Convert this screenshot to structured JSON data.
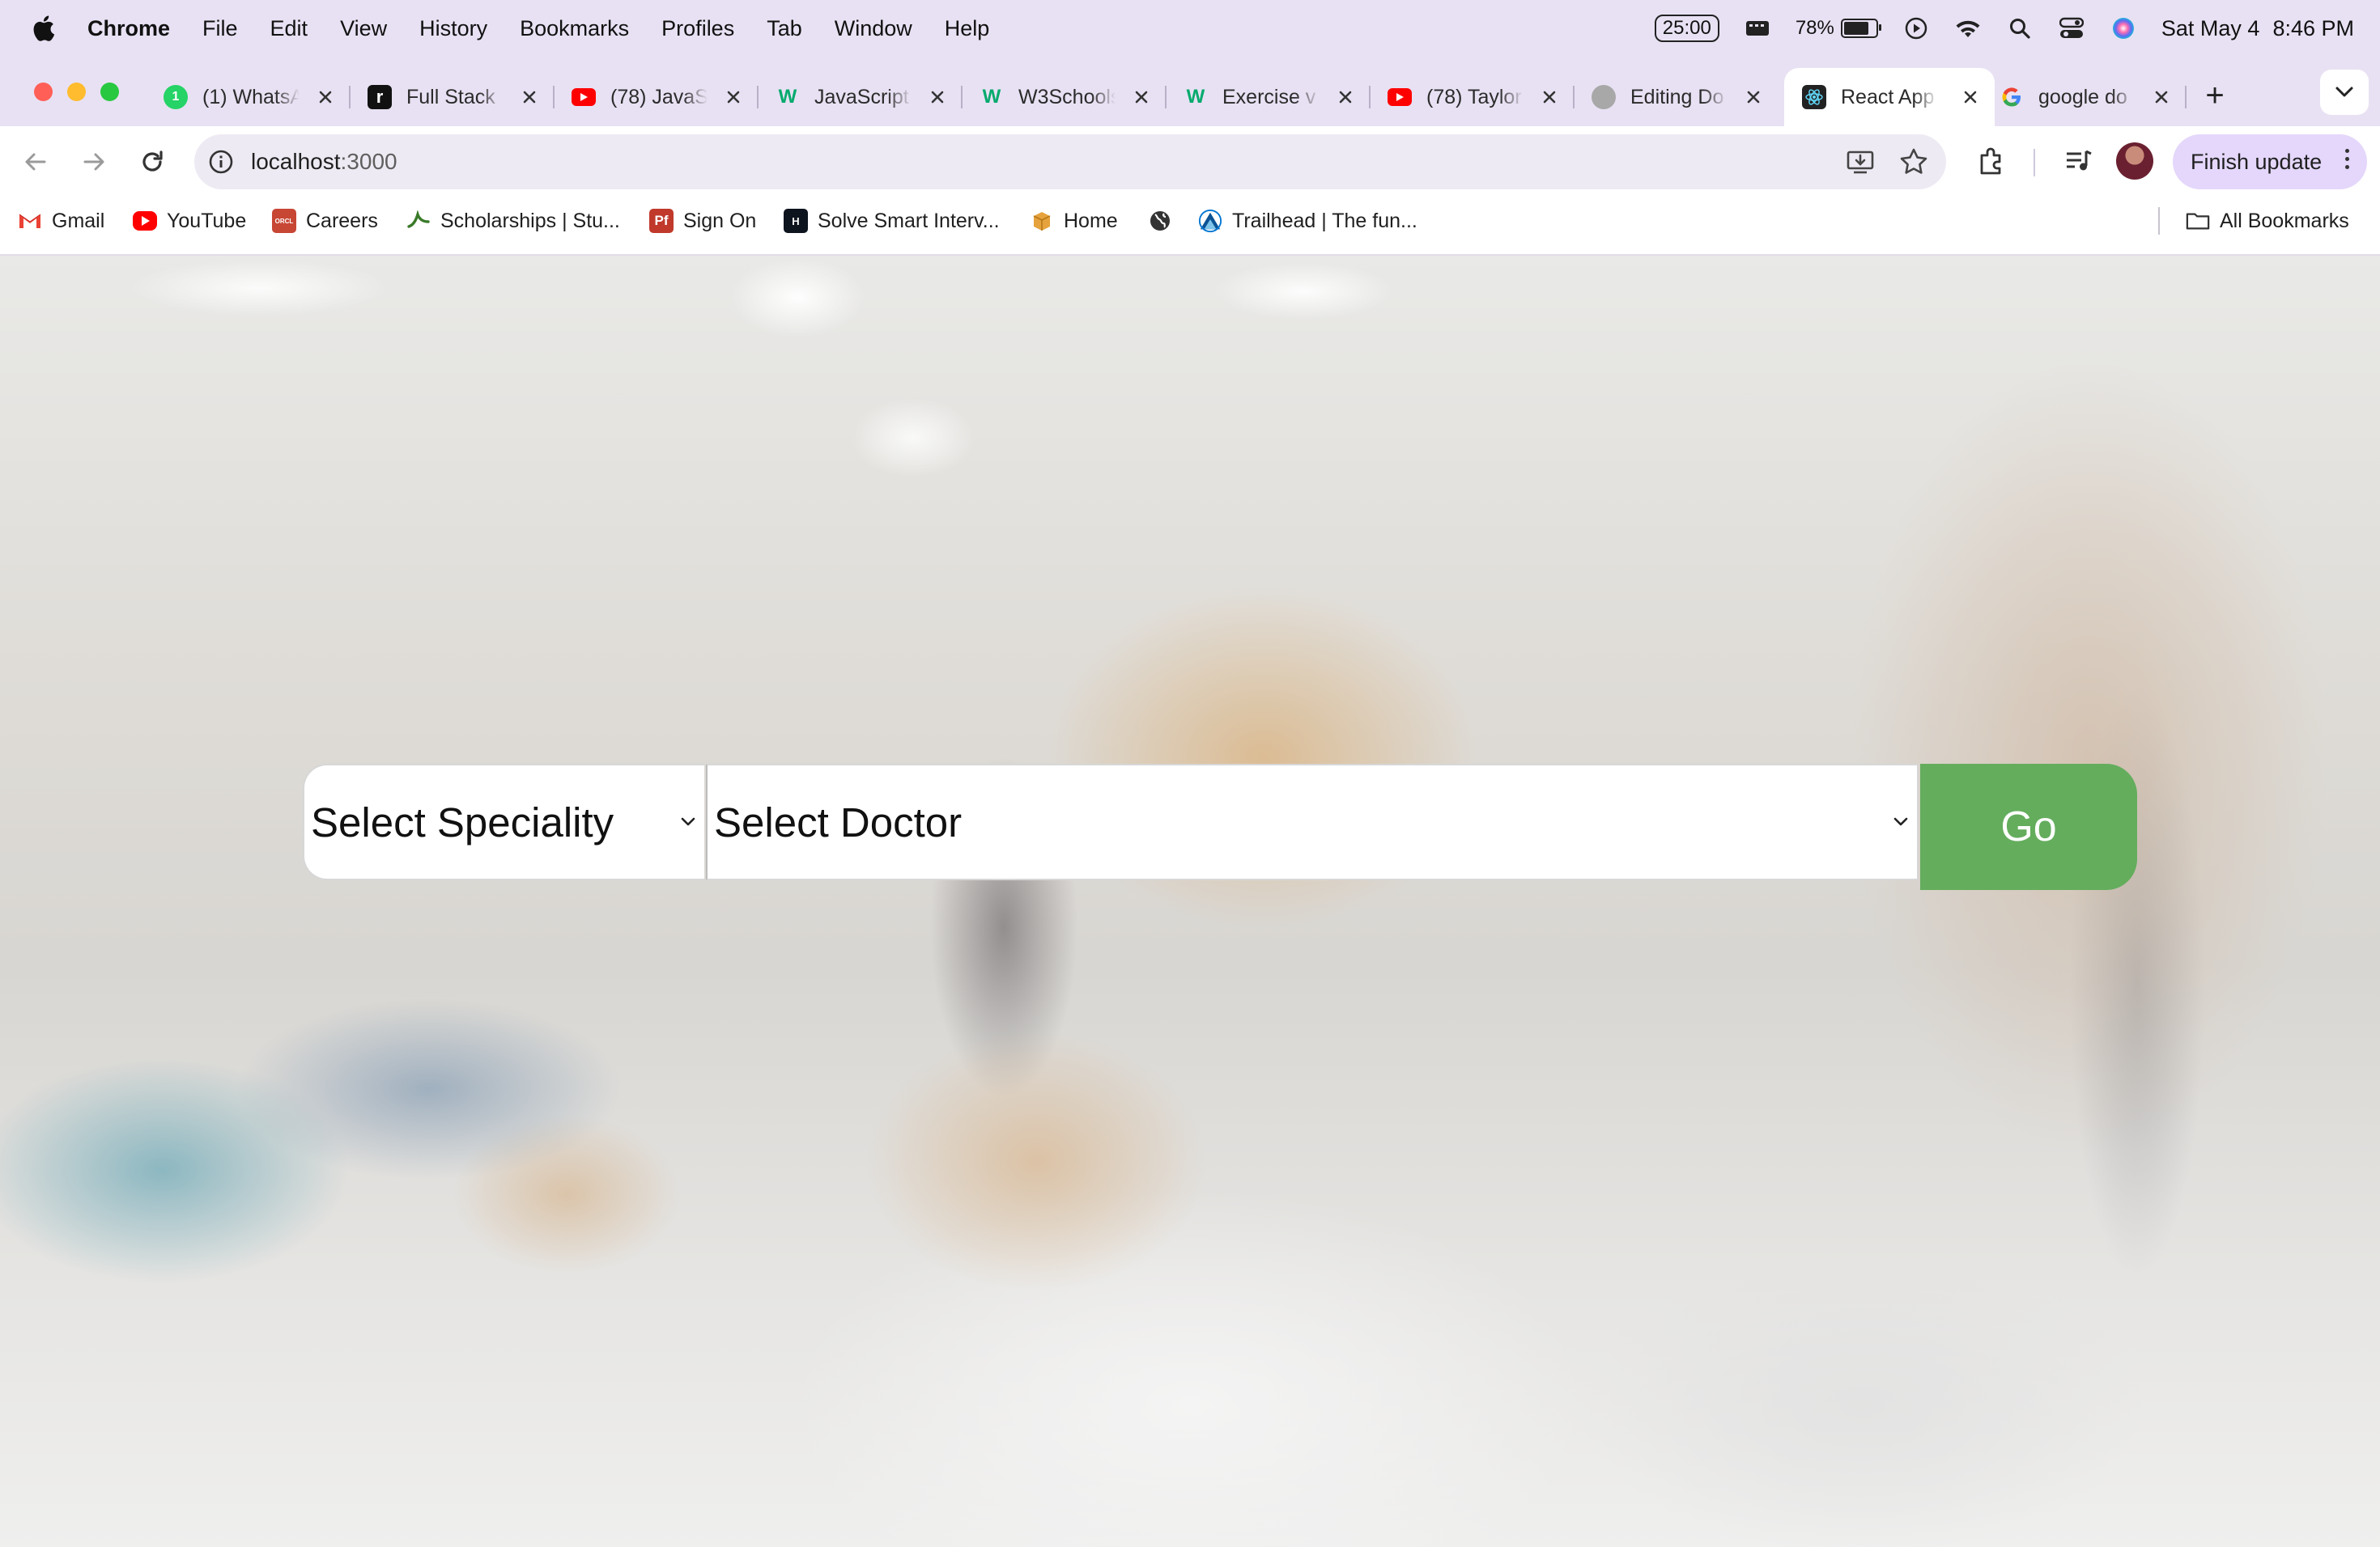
{
  "menubar": {
    "app_name": "Chrome",
    "items": [
      "File",
      "Edit",
      "View",
      "History",
      "Bookmarks",
      "Profiles",
      "Tab",
      "Window",
      "Help"
    ],
    "timer": "25:00",
    "battery_percent": "78%",
    "battery_level": 0.78,
    "date": "Sat May 4",
    "time": "8:46 PM"
  },
  "tabs": [
    {
      "title": "(1) WhatsApp",
      "icon": "whatsapp-icon",
      "color": "#25d366",
      "active": false
    },
    {
      "title": "Full Stack",
      "icon": "roadmap-icon",
      "color": "#111111",
      "active": false
    },
    {
      "title": "(78) JavaScript",
      "icon": "youtube-icon",
      "color": "#ff0000",
      "active": false
    },
    {
      "title": "JavaScript",
      "icon": "w3schools-icon",
      "color": "#04aa6d",
      "active": false
    },
    {
      "title": "W3Schools",
      "icon": "w3schools-icon",
      "color": "#04aa6d",
      "active": false
    },
    {
      "title": "Exercise v",
      "icon": "w3schools-icon",
      "color": "#04aa6d",
      "active": false
    },
    {
      "title": "(78) Taylor",
      "icon": "youtube-icon",
      "color": "#ff0000",
      "active": false
    },
    {
      "title": "Editing Do",
      "icon": "github-icon",
      "color": "#a8a8a8",
      "active": false
    },
    {
      "title": "React App",
      "icon": "react-icon",
      "color": "#61dafb",
      "active": true
    },
    {
      "title": "google do",
      "icon": "google-icon",
      "color": "#4285f4",
      "active": false
    }
  ],
  "toolbar": {
    "url_host": "localhost",
    "url_port": ":3000",
    "finish_update_label": "Finish update"
  },
  "bookmarks": [
    {
      "label": "Gmail",
      "icon": "gmail-icon",
      "color": "#ea4335"
    },
    {
      "label": "YouTube",
      "icon": "youtube-icon",
      "color": "#ff0000"
    },
    {
      "label": "Careers",
      "icon": "oracle-icon",
      "color": "#c74634"
    },
    {
      "label": "Scholarships | Stu...",
      "icon": "scholarship-icon",
      "color": "#3a7a2a"
    },
    {
      "label": "Sign On",
      "icon": "pf-icon",
      "color": "#c0392b"
    },
    {
      "label": "Solve Smart Interv...",
      "icon": "hackerrank-icon",
      "color": "#0e141e"
    },
    {
      "label": "Home",
      "icon": "box-icon",
      "color": "#e6a23c"
    },
    {
      "label": "",
      "icon": "globe-icon",
      "color": "#333333"
    },
    {
      "label": "Trailhead | The fun...",
      "icon": "trailhead-icon",
      "color": "#0176d3"
    }
  ],
  "all_bookmarks_label": "All Bookmarks",
  "page": {
    "speciality_select": {
      "value": "Select Speciality"
    },
    "doctor_select": {
      "value": "Select Doctor"
    },
    "go_button_label": "Go",
    "accent_color": "#64ad5d"
  }
}
